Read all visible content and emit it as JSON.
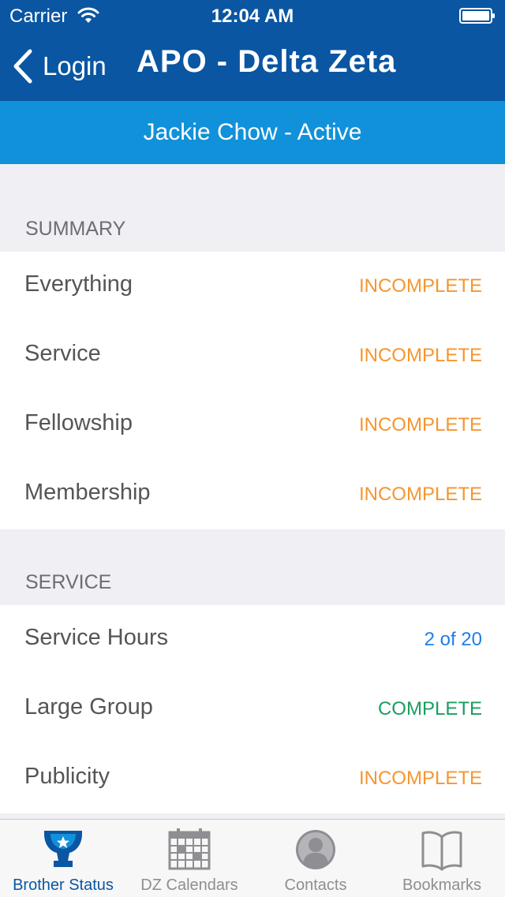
{
  "status_bar": {
    "carrier": "Carrier",
    "time": "12:04 AM"
  },
  "nav": {
    "back_label": "Login",
    "title": "APO - Delta Zeta"
  },
  "subheader": {
    "text": "Jackie Chow - Active"
  },
  "summary": {
    "header": "SUMMARY",
    "rows": [
      {
        "label": "Everything",
        "value": "INCOMPLETE",
        "status": "incomplete"
      },
      {
        "label": "Service",
        "value": "INCOMPLETE",
        "status": "incomplete"
      },
      {
        "label": "Fellowship",
        "value": "INCOMPLETE",
        "status": "incomplete"
      },
      {
        "label": "Membership",
        "value": "INCOMPLETE",
        "status": "incomplete"
      }
    ]
  },
  "service": {
    "header": "SERVICE",
    "rows": [
      {
        "label": "Service Hours",
        "value": "2 of 20",
        "status": "count"
      },
      {
        "label": "Large Group",
        "value": "COMPLETE",
        "status": "complete"
      },
      {
        "label": "Publicity",
        "value": "INCOMPLETE",
        "status": "incomplete"
      }
    ]
  },
  "tabs": [
    {
      "label": "Brother Status",
      "icon": "trophy-icon",
      "active": true
    },
    {
      "label": "DZ Calendars",
      "icon": "calendar-icon",
      "active": false
    },
    {
      "label": "Contacts",
      "icon": "contact-icon",
      "active": false
    },
    {
      "label": "Bookmarks",
      "icon": "book-icon",
      "active": false
    }
  ],
  "colors": {
    "nav_bar": "#0a56a2",
    "subheader": "#1191d9",
    "incomplete": "#f5962f",
    "complete": "#1a9e5f",
    "count": "#1d7fe6",
    "active_tab": "#0a56a2"
  }
}
